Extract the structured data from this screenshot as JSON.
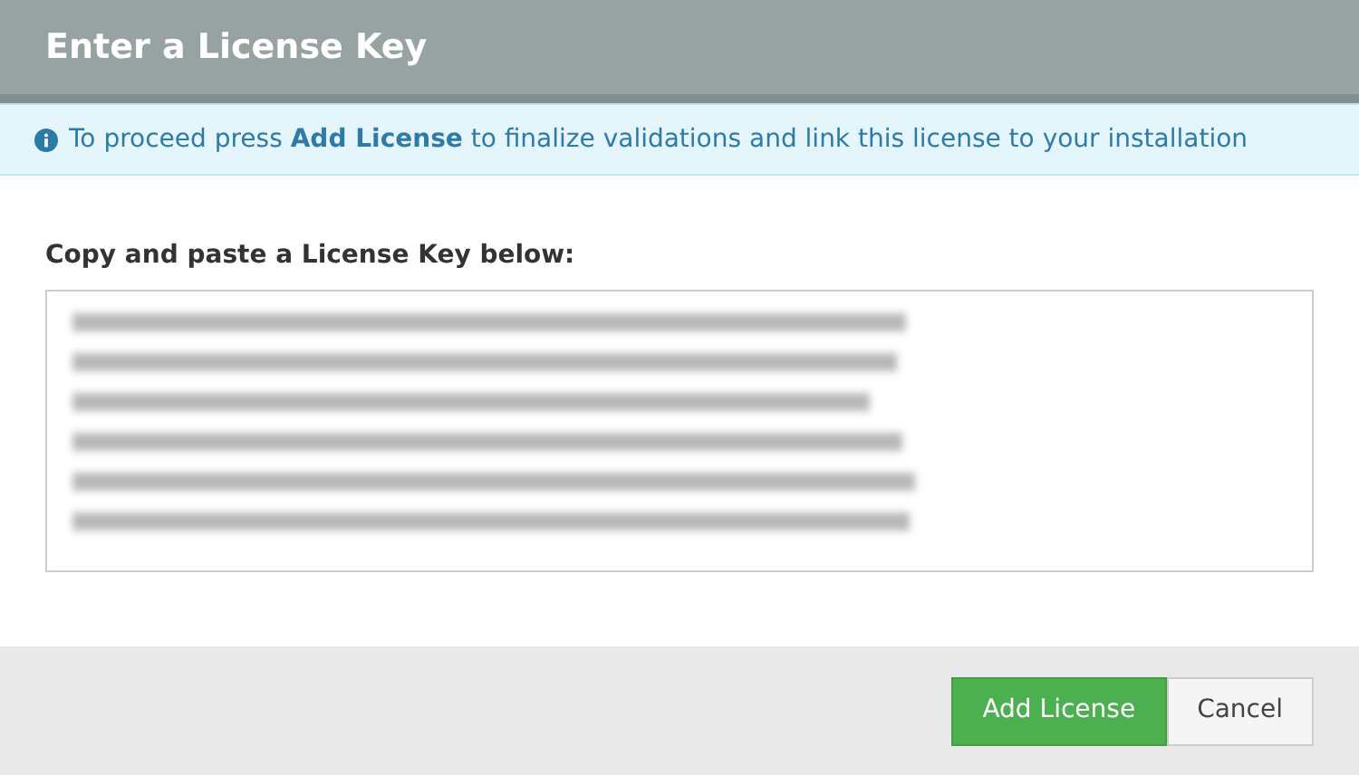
{
  "dialog": {
    "title": "Enter a License Key",
    "info": "To proceed press **Add License** to finalize validations and link this license to your installation",
    "field_label": "Copy and paste a License Key below:",
    "buttons": [
      {
        "label": "Add License",
        "kind": "primary"
      },
      {
        "label": "Cancel",
        "kind": "default"
      }
    ]
  }
}
